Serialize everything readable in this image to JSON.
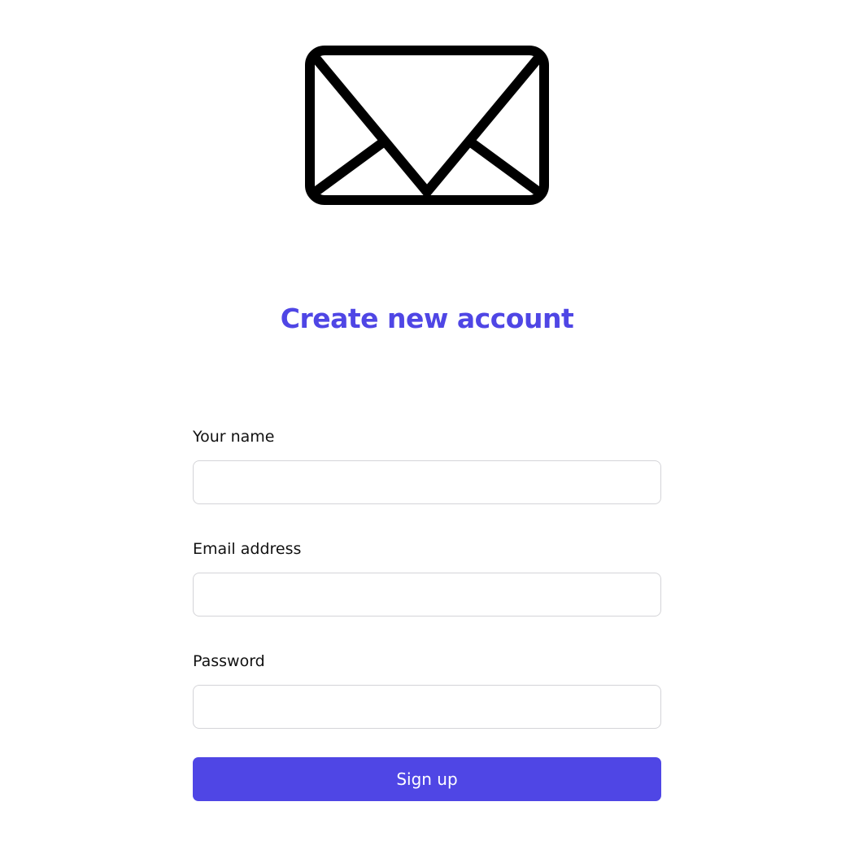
{
  "logo": {
    "icon": "envelope-icon",
    "color": "#000000"
  },
  "title": "Create new account",
  "form": {
    "fields": [
      {
        "label": "Your name",
        "value": "",
        "placeholder": ""
      },
      {
        "label": "Email address",
        "value": "",
        "placeholder": ""
      },
      {
        "label": "Password",
        "value": "",
        "placeholder": ""
      }
    ],
    "submit_label": "Sign up"
  },
  "colors": {
    "accent": "#4f46e5",
    "input_border": "#d4d4d8",
    "text": "#111111",
    "background": "#ffffff"
  }
}
